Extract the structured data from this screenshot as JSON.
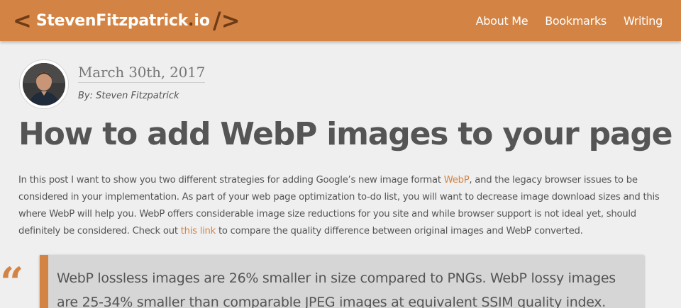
{
  "header": {
    "brand_name": "StevenFitzpatrick",
    "brand_dot": ".",
    "brand_tld": "io",
    "brand_bracket_left": "<",
    "brand_bracket_right": "/>",
    "nav": [
      {
        "label": "About Me"
      },
      {
        "label": "Bookmarks"
      },
      {
        "label": "Writing"
      }
    ],
    "accent_color": "#d38444",
    "accent_dark": "#6d3b16"
  },
  "post": {
    "date": "March 30th, 2017",
    "author": "By: Steven Fitzpatrick",
    "title": "How to add WebP images to your page",
    "intro": {
      "part1": "In this post I want to show you two different strategies for adding Google’s new image format ",
      "link1": "WebP",
      "part2": ", and the legacy browser issues to be considered in your implementation. As part of your web page optimization to-do list, you will want to decrease image download sizes and this where WebP will help you. WebP offers considerable image size reductions for you site and while browser support is not ideal yet, should definitely be considered. Check out ",
      "link2": "this link",
      "part3": " to compare the quality difference between original images and WebP converted."
    },
    "blockquote": "WebP lossless images are 26% smaller in size compared to PNGs. WebP lossy images are 25-34% smaller than comparable JPEG images at equivalent SSIM quality index.",
    "quote_glyph": "“"
  }
}
